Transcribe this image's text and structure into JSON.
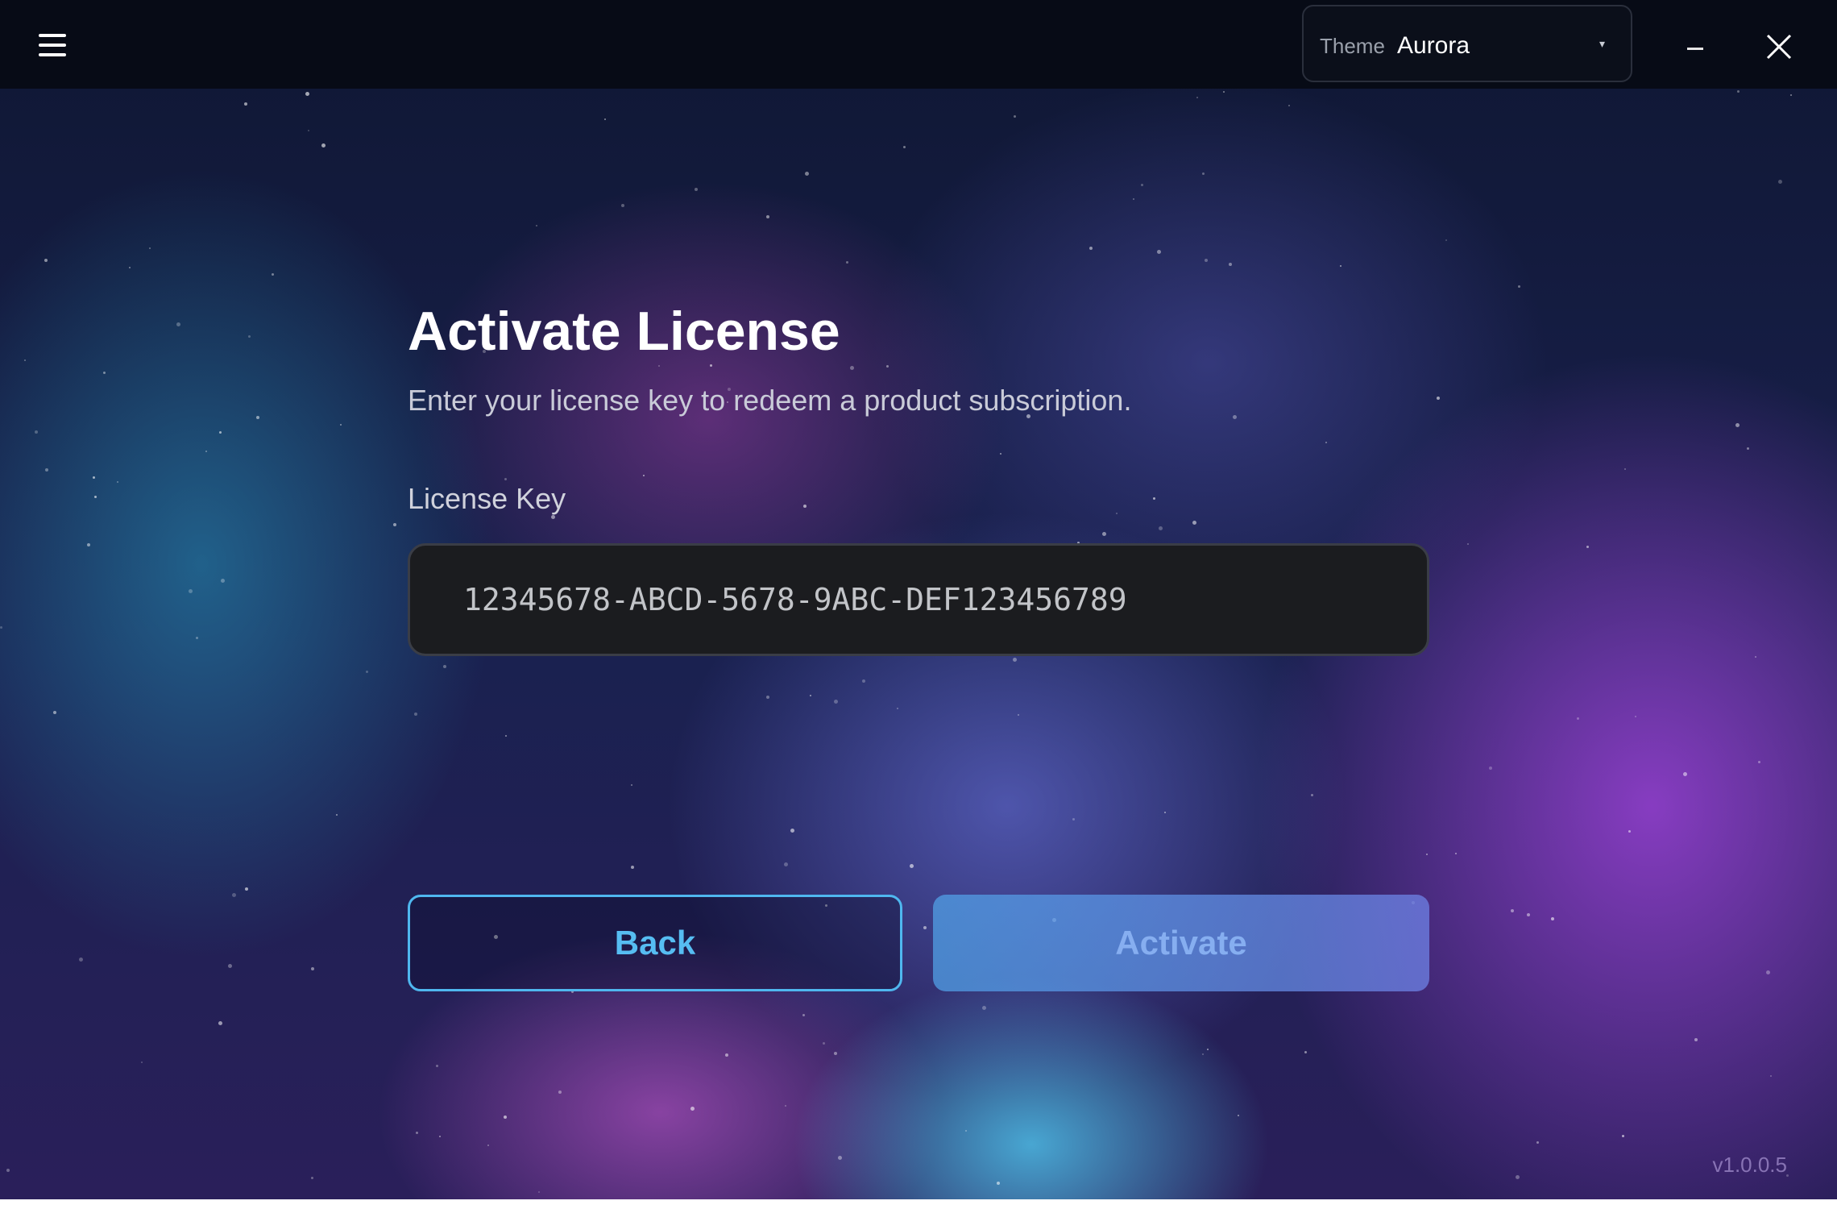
{
  "titlebar": {
    "menu_icon": "hamburger-menu-icon",
    "theme_label": "Theme",
    "theme_value": "Aurora",
    "caret_glyph": "▾",
    "minimize_icon": "minimize-icon",
    "close_icon": "close-icon"
  },
  "main": {
    "title": "Activate License",
    "subtitle": "Enter your license key to redeem a product subscription.",
    "license_label": "License Key",
    "license_value": "12345678-ABCD-5678-9ABC-DEF123456789",
    "back_label": "Back",
    "activate_label": "Activate"
  },
  "footer": {
    "version": "v1.0.0.5"
  },
  "colors": {
    "titlebar_bg": "#070b16",
    "accent": "#4fb7ef",
    "input_bg": "#1b1c1f",
    "activate_bg": "#6aa3ea"
  }
}
